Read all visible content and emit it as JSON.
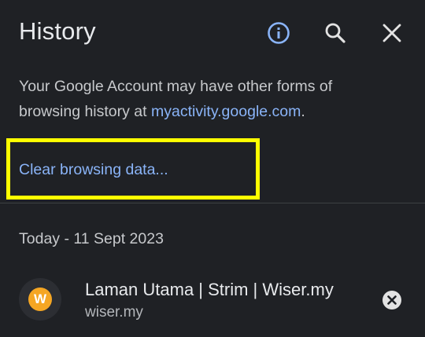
{
  "header": {
    "title": "History",
    "icons": [
      "info-icon",
      "search-icon",
      "close-icon"
    ]
  },
  "notice": {
    "text_before": "Your Google Account may have other forms of browsing history at ",
    "link_text": "myactivity.google.com",
    "text_after": "."
  },
  "clear_browsing_data": {
    "label": "Clear browsing data..."
  },
  "history": {
    "date_header": "Today - 11 Sept 2023",
    "entries": [
      {
        "favicon_letter": "W",
        "title": "Laman Utama | Strim | Wiser.my",
        "url": "wiser.my"
      }
    ]
  },
  "colors": {
    "background": "#1f2125",
    "link": "#8ab4f8",
    "highlight": "#ffff00",
    "favicon": "#f5a623"
  }
}
